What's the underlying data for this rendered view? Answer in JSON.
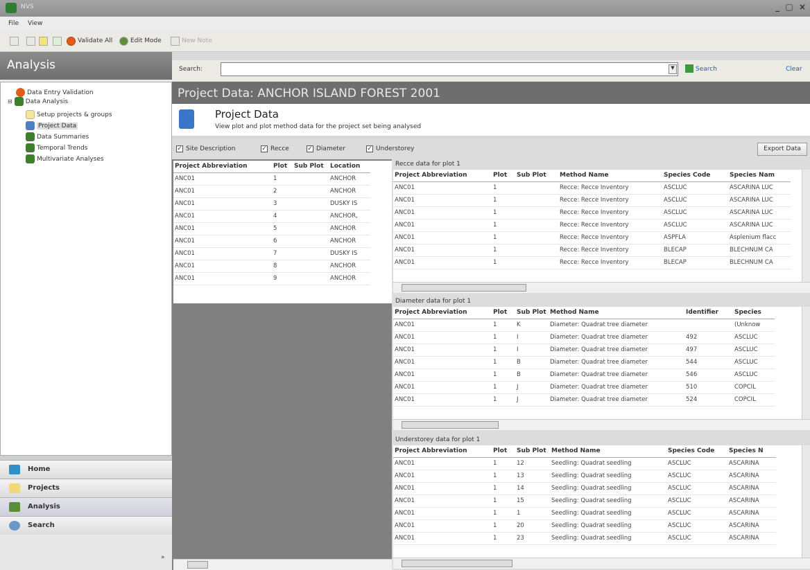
{
  "window": {
    "title": "NVS"
  },
  "menu": {
    "file": "File",
    "view": "View"
  },
  "toolbar": {
    "validate": "Validate All",
    "edit": "Edit Mode",
    "newnote": "New Note"
  },
  "left": {
    "title": "Analysis",
    "tree": {
      "validation": "Data Entry Validation",
      "analysis": "Data Analysis",
      "setup": "Setup projects & groups",
      "projectdata": "Project Data",
      "summaries": "Data Summaries",
      "trends": "Temporal Trends",
      "multivariate": "Multivariate Analyses"
    },
    "nav": {
      "home": "Home",
      "projects": "Projects",
      "analysis": "Analysis",
      "search": "Search"
    }
  },
  "search": {
    "label": "Search:",
    "button": "Search",
    "clear": "Clear"
  },
  "main": {
    "title": "Project Data: ANCHOR ISLAND FOREST 2001",
    "heading": "Project Data",
    "desc": "View plot and plot method data for the project set being analysed",
    "checks": {
      "site": "Site Description",
      "recce": "Recce",
      "diameter": "Diameter",
      "understorey": "Understorey"
    },
    "export": "Export Data"
  },
  "plots": {
    "headers": [
      "Project Abbreviation",
      "Plot",
      "Sub Plot",
      "Location"
    ],
    "rows": [
      [
        "ANC01",
        "1",
        "",
        "ANCHOR"
      ],
      [
        "ANC01",
        "2",
        "",
        "ANCHOR"
      ],
      [
        "ANC01",
        "3",
        "",
        "DUSKY IS"
      ],
      [
        "ANC01",
        "4",
        "",
        "ANCHOR,"
      ],
      [
        "ANC01",
        "5",
        "",
        "ANCHOR"
      ],
      [
        "ANC01",
        "6",
        "",
        "ANCHOR"
      ],
      [
        "ANC01",
        "7",
        "",
        "DUSKY IS"
      ],
      [
        "ANC01",
        "8",
        "",
        "ANCHOR"
      ],
      [
        "ANC01",
        "9",
        "",
        "ANCHOR"
      ]
    ]
  },
  "recce": {
    "label": "Recce data for plot 1",
    "headers": [
      "Project Abbreviation",
      "Plot",
      "Sub Plot",
      "Method Name",
      "Species Code",
      "Species Nam"
    ],
    "rows": [
      [
        "ANC01",
        "1",
        "",
        "Recce: Recce Inventory",
        "ASCLUC",
        "ASCARINA LUC"
      ],
      [
        "ANC01",
        "1",
        "",
        "Recce: Recce Inventory",
        "ASCLUC",
        "ASCARINA LUC"
      ],
      [
        "ANC01",
        "1",
        "",
        "Recce: Recce Inventory",
        "ASCLUC",
        "ASCARINA LUC"
      ],
      [
        "ANC01",
        "1",
        "",
        "Recce: Recce Inventory",
        "ASCLUC",
        "ASCARINA LUC"
      ],
      [
        "ANC01",
        "1",
        "",
        "Recce: Recce Inventory",
        "ASPFLA",
        "Asplenium flacc"
      ],
      [
        "ANC01",
        "1",
        "",
        "Recce: Recce Inventory",
        "BLECAP",
        "BLECHNUM CA"
      ],
      [
        "ANC01",
        "1",
        "",
        "Recce: Recce Inventory",
        "BLECAP",
        "BLECHNUM CA"
      ]
    ]
  },
  "diameter": {
    "label": "Diameter data for plot 1",
    "headers": [
      "Project Abbreviation",
      "Plot",
      "Sub Plot",
      "Method Name",
      "Identifier",
      "Species"
    ],
    "rows": [
      [
        "ANC01",
        "1",
        "K",
        "Diameter: Quadrat tree diameter",
        "",
        "(Unknow"
      ],
      [
        "ANC01",
        "1",
        "I",
        "Diameter: Quadrat tree diameter",
        "492",
        "ASCLUC"
      ],
      [
        "ANC01",
        "1",
        "I",
        "Diameter: Quadrat tree diameter",
        "497",
        "ASCLUC"
      ],
      [
        "ANC01",
        "1",
        "B",
        "Diameter: Quadrat tree diameter",
        "544",
        "ASCLUC"
      ],
      [
        "ANC01",
        "1",
        "B",
        "Diameter: Quadrat tree diameter",
        "546",
        "ASCLUC"
      ],
      [
        "ANC01",
        "1",
        "J",
        "Diameter: Quadrat tree diameter",
        "510",
        "COPCIL"
      ],
      [
        "ANC01",
        "1",
        "J",
        "Diameter: Quadrat tree diameter",
        "524",
        "COPCIL"
      ]
    ]
  },
  "understorey": {
    "label": "Understorey data for plot 1",
    "headers": [
      "Project Abbreviation",
      "Plot",
      "Sub Plot",
      "Method Name",
      "Species Code",
      "Species N"
    ],
    "rows": [
      [
        "ANC01",
        "1",
        "12",
        "Seedling: Quadrat seedling",
        "ASCLUC",
        "ASCARINA"
      ],
      [
        "ANC01",
        "1",
        "13",
        "Seedling: Quadrat seedling",
        "ASCLUC",
        "ASCARINA"
      ],
      [
        "ANC01",
        "1",
        "14",
        "Seedling: Quadrat seedling",
        "ASCLUC",
        "ASCARINA"
      ],
      [
        "ANC01",
        "1",
        "15",
        "Seedling: Quadrat seedling",
        "ASCLUC",
        "ASCARINA"
      ],
      [
        "ANC01",
        "1",
        "1",
        "Seedling: Quadrat seedling",
        "ASCLUC",
        "ASCARINA"
      ],
      [
        "ANC01",
        "1",
        "20",
        "Seedling: Quadrat seedling",
        "ASCLUC",
        "ASCARINA"
      ],
      [
        "ANC01",
        "1",
        "23",
        "Seedling: Quadrat seedling",
        "ASCLUC",
        "ASCARINA"
      ]
    ]
  }
}
